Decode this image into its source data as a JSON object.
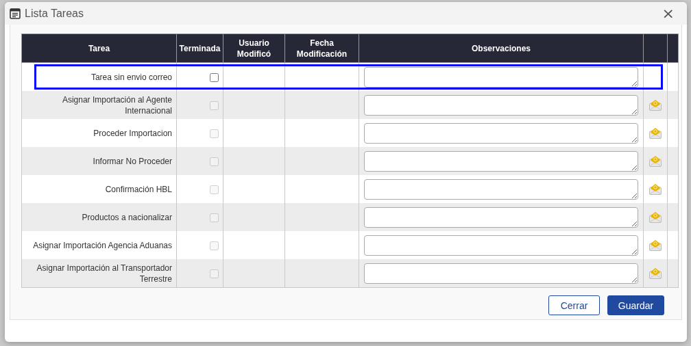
{
  "dialog": {
    "title": "Lista Tareas",
    "close": "×"
  },
  "table": {
    "columns": [
      "Tarea",
      "Terminada",
      "Usuario Modificó",
      "Fecha Modificación",
      "Observaciones"
    ],
    "rows": [
      {
        "task": "Tarea sin envio correo",
        "checked": false,
        "disabled": false,
        "mail": false,
        "highlighted": true
      },
      {
        "task": "Asignar Importación al Agente Internacional",
        "checked": false,
        "disabled": true,
        "mail": true,
        "highlighted": false
      },
      {
        "task": "Proceder Importacion",
        "checked": false,
        "disabled": true,
        "mail": true,
        "highlighted": false
      },
      {
        "task": "Informar No Proceder",
        "checked": false,
        "disabled": true,
        "mail": true,
        "highlighted": false
      },
      {
        "task": "Confirmación HBL",
        "checked": false,
        "disabled": true,
        "mail": true,
        "highlighted": false
      },
      {
        "task": "Productos a nacionalizar",
        "checked": false,
        "disabled": true,
        "mail": true,
        "highlighted": false
      },
      {
        "task": "Asignar Importación Agencia Aduanas",
        "checked": false,
        "disabled": true,
        "mail": true,
        "highlighted": false
      },
      {
        "task": "Asignar Importación al Transportador Terrestre",
        "checked": false,
        "disabled": true,
        "mail": true,
        "highlighted": false
      }
    ]
  },
  "buttons": [
    {
      "label": "Cerrar",
      "kind": "secondary"
    },
    {
      "label": "Guardar",
      "kind": "primary"
    }
  ]
}
